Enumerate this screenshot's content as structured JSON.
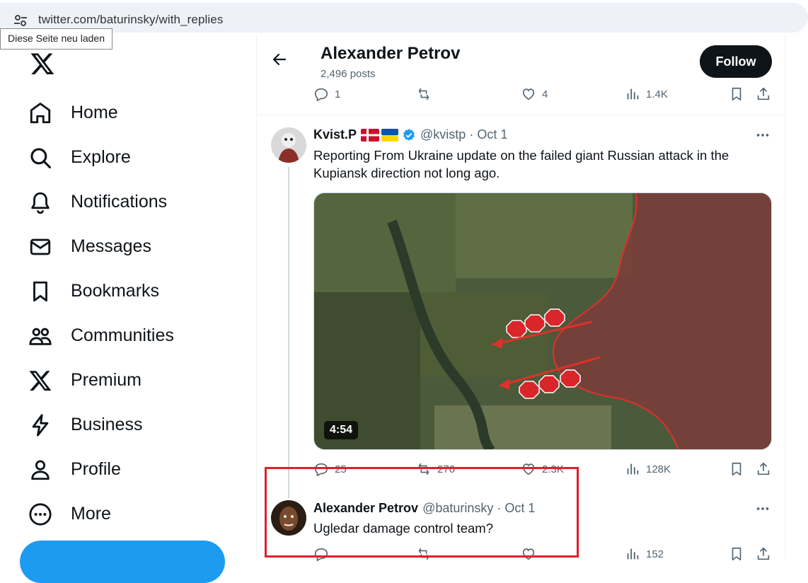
{
  "browser": {
    "url": "twitter.com/baturinsky/with_replies",
    "tooltip": "Diese Seite neu laden"
  },
  "nav": {
    "items": [
      {
        "label": "Home",
        "icon": "home-icon"
      },
      {
        "label": "Explore",
        "icon": "search-icon"
      },
      {
        "label": "Notifications",
        "icon": "bell-icon"
      },
      {
        "label": "Messages",
        "icon": "mail-icon"
      },
      {
        "label": "Bookmarks",
        "icon": "bookmark-icon"
      },
      {
        "label": "Communities",
        "icon": "people-icon"
      },
      {
        "label": "Premium",
        "icon": "x-icon"
      },
      {
        "label": "Business",
        "icon": "lightning-icon"
      },
      {
        "label": "Profile",
        "icon": "person-icon"
      },
      {
        "label": "More",
        "icon": "more-circle-icon"
      }
    ]
  },
  "header": {
    "name": "Alexander Petrov",
    "posts": "2,496 posts",
    "follow_label": "Follow"
  },
  "prev_actions": {
    "replies": "1",
    "reposts": "",
    "likes": "4",
    "views": "1.4K"
  },
  "tweet1": {
    "name": "Kvist.P",
    "handle": "@kvistp",
    "date": "Oct 1",
    "text": "Reporting From Ukraine update on the failed giant Russian attack in the Kupiansk direction not long ago.",
    "video_duration": "4:54",
    "actions": {
      "replies": "25",
      "reposts": "276",
      "likes": "2.3K",
      "views": "128K"
    }
  },
  "tweet2": {
    "name": "Alexander Petrov",
    "handle": "@baturinsky",
    "date": "Oct 1",
    "text": "Ugledar damage control team?",
    "actions": {
      "replies": "",
      "reposts": "",
      "likes": "",
      "views": "152"
    }
  },
  "colors": {
    "accent": "#1d9bf0",
    "highlight": "#e0202a",
    "verified": "#1d9bf0"
  }
}
